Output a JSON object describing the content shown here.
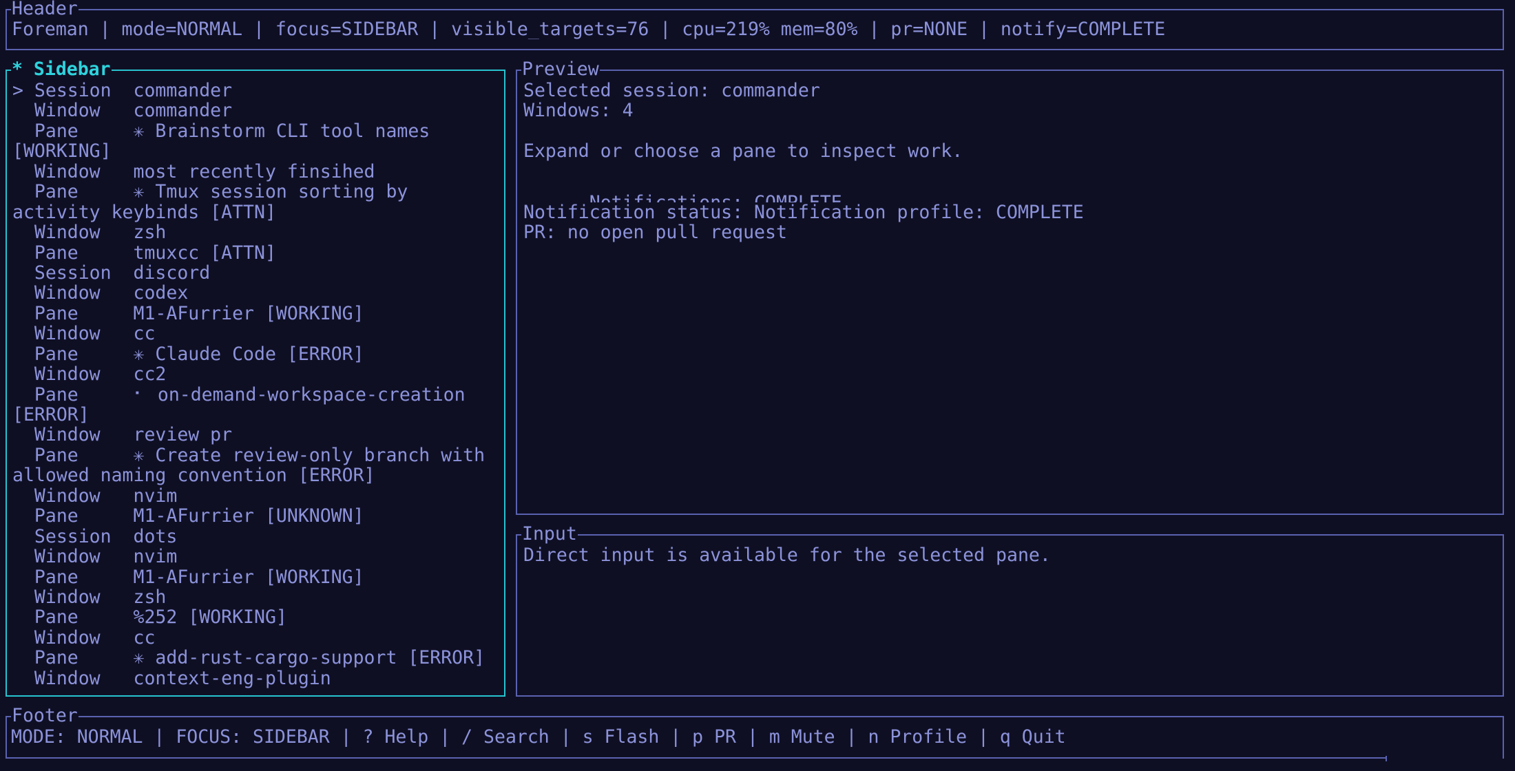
{
  "header": {
    "title": "Header",
    "status_line": "Foreman | mode=NORMAL | focus=SIDEBAR | visible_targets=76 | cpu=219% mem=80% | pr=NONE | notify=COMPLETE"
  },
  "sidebar": {
    "title": "* Sidebar",
    "lines": [
      "> Session  commander",
      "  Window   commander",
      "  Pane     ✳ Brainstorm CLI tool names",
      "[WORKING]",
      "  Window   most recently finsihed",
      "  Pane     ✳ Tmux session sorting by",
      "activity keybinds [ATTN]",
      "  Window   zsh",
      "  Pane     tmuxcc [ATTN]",
      "  Session  discord",
      "  Window   codex",
      "  Pane     M1-AFurrier [WORKING]",
      "  Window   cc",
      "  Pane     ✳ Claude Code [ERROR]",
      "  Window   cc2",
      "  Pane     ⠂ on-demand-workspace-creation",
      "[ERROR]",
      "  Window   review pr",
      "  Pane     ✳ Create review-only branch with",
      "allowed naming convention [ERROR]",
      "  Window   nvim",
      "  Pane     M1-AFurrier [UNKNOWN]",
      "  Session  dots",
      "  Window   nvim",
      "  Pane     M1-AFurrier [WORKING]",
      "  Window   zsh",
      "  Pane     %252 [WORKING]",
      "  Window   cc",
      "  Pane     ✳ add-rust-cargo-support [ERROR]",
      "  Window   context-eng-plugin"
    ]
  },
  "preview": {
    "title": "Preview",
    "lines": [
      "Selected session: commander",
      "Windows: 4",
      "",
      "Expand or choose a pane to inspect work."
    ],
    "partial_line": "Notifications: COMPLETE",
    "lines_after": [
      "Notification status: Notification profile: COMPLETE",
      "PR: no open pull request"
    ]
  },
  "input": {
    "title": "Input",
    "text": "Direct input is available for the selected pane."
  },
  "footer": {
    "title": "Footer",
    "text": "MODE: NORMAL | FOCUS: SIDEBAR | ? Help | / Search | s Flash | p PR | m Mute | n Profile | q Quit"
  },
  "colors": {
    "background": "#0f0f24",
    "text": "#8c93da",
    "border": "#5a62b0",
    "focus": "#27c4cf"
  }
}
